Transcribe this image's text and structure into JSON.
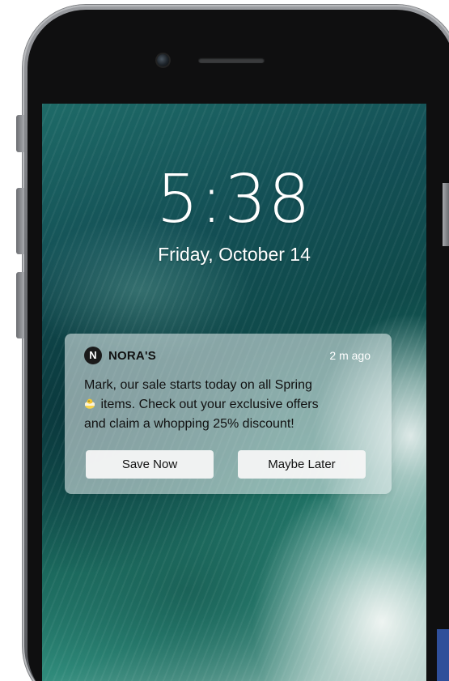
{
  "lock_screen": {
    "time": "5:38",
    "date": "Friday, October 14"
  },
  "notification": {
    "app_icon_letter": "N",
    "app_name": "NORA'S",
    "time_ago": "2 m ago",
    "message_line1": "Mark, our sale starts today on all Spring",
    "emoji": "hatching-chick-emoji",
    "message_line2": " items. Check out your exclusive offers",
    "message_line3": "and claim a whopping 25% discount!",
    "actions": {
      "primary": "Save Now",
      "secondary": "Maybe Later"
    }
  },
  "colors": {
    "notification_bg": "#e8f0f0",
    "text": "#111111",
    "accent_tab": "#2f4f9a"
  }
}
